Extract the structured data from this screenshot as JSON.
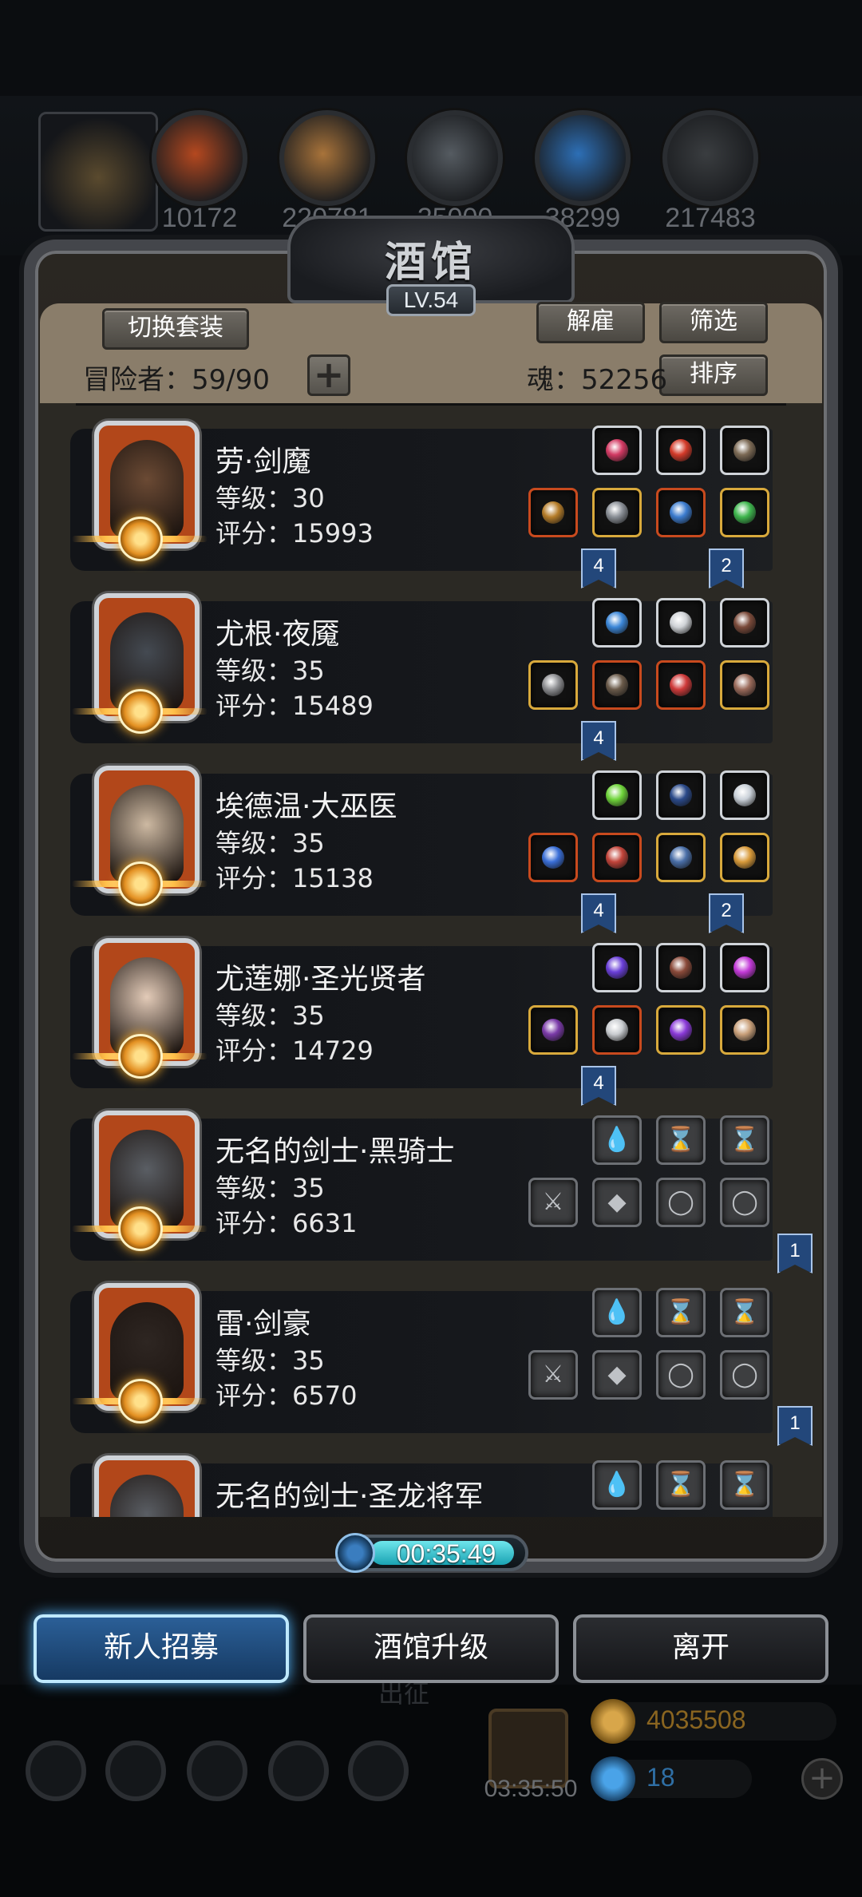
{
  "top": {
    "resources": [
      "10172",
      "220781",
      "25000",
      "38299",
      "217483"
    ],
    "colors": [
      "#b4481f",
      "#a8733a",
      "#555b61",
      "#2d6fb6",
      "#3a3d40"
    ]
  },
  "tavern": {
    "title": "酒馆",
    "level": "LV.54",
    "switch_set": "切换套装",
    "dismiss": "解雇",
    "filter": "筛选",
    "sort": "排序",
    "adventurers_label": "冒险者：59/90",
    "soul_label": "魂：52256",
    "plus": "+"
  },
  "heroes": [
    {
      "name": "劳·剑魔",
      "level": "等级：30",
      "score": "评分：15993",
      "face": "#6b4a34",
      "top_slots": [
        {
          "c": "#d23a63"
        },
        {
          "c": "#d43b2a"
        },
        {
          "c": "#7c6a55"
        }
      ],
      "bottom_slots": [
        {
          "c": "#b57d2a",
          "b": "red"
        },
        {
          "c": "#8a8f96",
          "b": "gold"
        },
        {
          "c": "#3c7ccf",
          "b": "red"
        },
        {
          "c": "#3fb64e",
          "b": "gold"
        }
      ],
      "ribbons": [
        "4",
        "2"
      ]
    },
    {
      "name": "尤根·夜魇",
      "level": "等级：35",
      "score": "评分：15489",
      "face": "#444a52",
      "top_slots": [
        {
          "c": "#3c87d8"
        },
        {
          "c": "#cfd2d6"
        },
        {
          "c": "#7a4a3a"
        }
      ],
      "bottom_slots": [
        {
          "c": "#8e8f92",
          "b": "gold"
        },
        {
          "c": "#6a5a4a",
          "b": "red"
        },
        {
          "c": "#cf3a3a",
          "b": "red"
        },
        {
          "c": "#9a6a5a",
          "b": "gold"
        }
      ],
      "ribbons": [
        "4"
      ]
    },
    {
      "name": "埃德温·大巫医",
      "level": "等级：35",
      "score": "评分：15138",
      "face": "#cdb9a2",
      "top_slots": [
        {
          "c": "#6fd43a"
        },
        {
          "c": "#2b4a8a"
        },
        {
          "c": "#c9d0d8"
        }
      ],
      "bottom_slots": [
        {
          "c": "#3a6fd8",
          "b": "red"
        },
        {
          "c": "#c2443a",
          "b": "red"
        },
        {
          "c": "#4a6fa8",
          "b": "gold"
        },
        {
          "c": "#d89a3a",
          "b": "gold"
        }
      ],
      "ribbons": [
        "4",
        "2"
      ]
    },
    {
      "name": "尤莲娜·圣光贤者",
      "level": "等级：35",
      "score": "评分：14729",
      "face": "#e3cbb8",
      "top_slots": [
        {
          "c": "#6a3fd8"
        },
        {
          "c": "#8a4a3a"
        },
        {
          "c": "#c33ad8"
        }
      ],
      "bottom_slots": [
        {
          "c": "#7a3aa8",
          "b": "gold"
        },
        {
          "c": "#c9ccd0",
          "b": "red"
        },
        {
          "c": "#8a3ad8",
          "b": "gold"
        },
        {
          "c": "#c9a07a",
          "b": "gold"
        }
      ],
      "ribbons": [
        "4"
      ]
    },
    {
      "name": "无名的剑士·黑骑士",
      "level": "等级：35",
      "score": "评分：6631",
      "face": "#5a5e64",
      "empty": true,
      "ribbons_right": [
        "1"
      ]
    },
    {
      "name": "雷·剑豪",
      "level": "等级：35",
      "score": "评分：6570",
      "face": "#2e2622",
      "empty": true,
      "ribbons_right": [
        "1"
      ]
    },
    {
      "name": "无名的剑士·圣龙将军",
      "face": "#5a5e64",
      "empty": true,
      "partial": true
    }
  ],
  "timer": "00:35:49",
  "buttons": {
    "recruit": "新人招募",
    "upgrade": "酒馆升级",
    "leave": "离开"
  },
  "hud": {
    "underlay_text": "出征",
    "gift_timer": "03:35:50",
    "gold": "4035508",
    "gems": "18"
  }
}
